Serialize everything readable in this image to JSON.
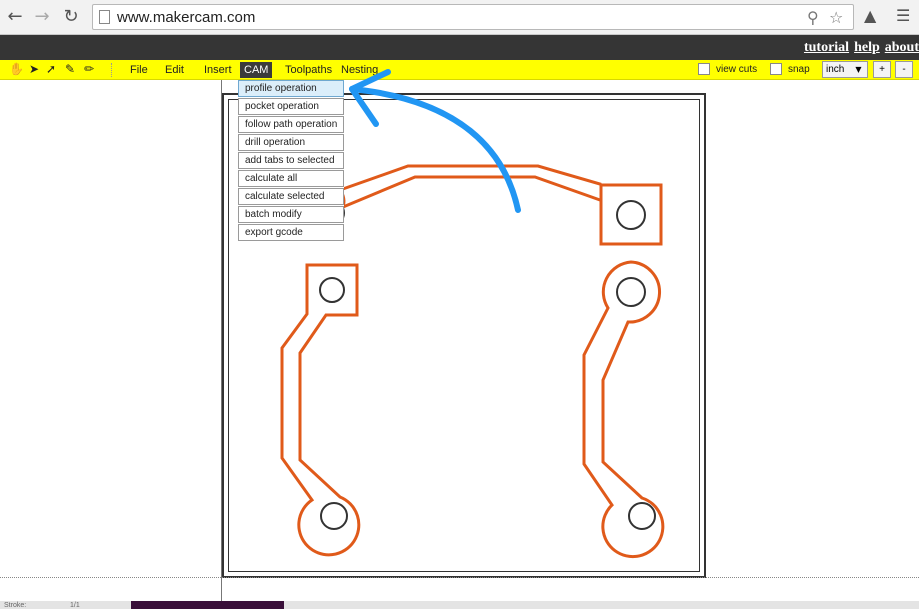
{
  "browser": {
    "back_icon": "back-arrow-icon",
    "forward_icon": "forward-arrow-icon",
    "reload_icon": "reload-icon",
    "url": "www.makercam.com"
  },
  "header_links": [
    "tutorial",
    "help",
    "about"
  ],
  "menubar": {
    "tool_icons": [
      "hand-icon",
      "select-arrow-icon",
      "node-select-icon",
      "pen-icon",
      "node-edit-icon"
    ],
    "menus": [
      "File",
      "Edit",
      "Insert",
      "CAM",
      "Toolpaths",
      "Nesting"
    ],
    "active_menu": "CAM",
    "view_cuts_label": "view cuts",
    "snap_label": "snap",
    "unit_value": "inch",
    "zoom_in_label": "+",
    "zoom_out_label": "-"
  },
  "cam_dropdown": {
    "items": [
      "profile operation",
      "pocket operation",
      "follow path operation",
      "drill operation",
      "add tabs to selected",
      "calculate all",
      "calculate selected",
      "batch modify",
      "export gcode"
    ],
    "highlighted": "profile operation"
  },
  "colors": {
    "menubar": "#ffff00",
    "trace": "#e05a1a",
    "annotation_arrow": "#2196f3",
    "dark_bar": "#353535"
  },
  "status_bar": {
    "label": "Stroke:",
    "value": "1/1"
  }
}
